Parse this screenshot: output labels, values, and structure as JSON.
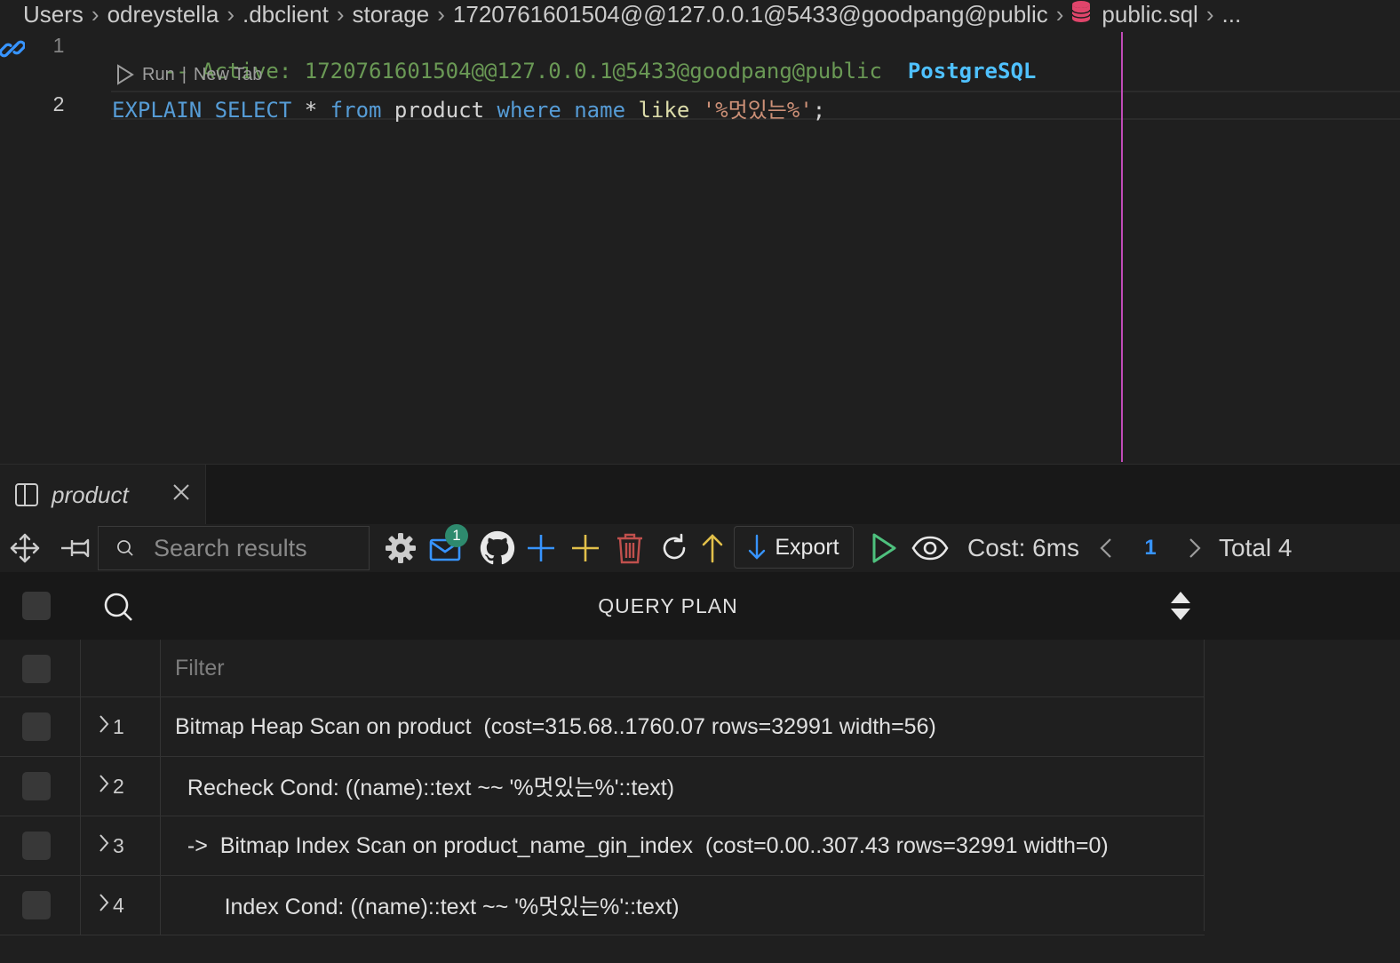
{
  "breadcrumb": {
    "segments": [
      "Users",
      ".dbclient",
      "storage",
      "1720761601504@@127.0.0.1@5433@goodpang@public",
      "public.sql",
      "..."
    ],
    "user": "odreystella"
  },
  "editor": {
    "line1": {
      "number": "1",
      "comment": "-- Active: 1720761601504@@127.0.0.1@5433@goodpang@public",
      "db_type": "PostgreSQL"
    },
    "codelens": {
      "run": "Run",
      "separator": "|",
      "new_tab": "New Tab"
    },
    "line2": {
      "number": "2",
      "explain": "EXPLAIN",
      "select": "SELECT",
      "star": "*",
      "from": "from",
      "table": "product",
      "where": "where",
      "column": "name",
      "like": "like",
      "literal": "'%멋있는%'",
      "semicolon": ";"
    }
  },
  "panel": {
    "tab_title": "product"
  },
  "toolbar": {
    "search_placeholder": "Search results",
    "mail_badge": "1",
    "export_label": "Export",
    "cost_label": "Cost: 6ms",
    "page": "1",
    "total_label": "Total 4"
  },
  "grid": {
    "column": "QUERY PLAN",
    "filter_placeholder": "Filter",
    "rows": [
      {
        "index": "1",
        "plan": "Bitmap Heap Scan on product  (cost=315.68..1760.07 rows=32991 width=56)"
      },
      {
        "index": "2",
        "plan": "  Recheck Cond: ((name)::text ~~ '%멋있는%'::text)"
      },
      {
        "index": "3",
        "plan": "  ->  Bitmap Index Scan on product_name_gin_index  (cost=0.00..307.43 rows=32991 width=0)"
      },
      {
        "index": "4",
        "plan": "        Index Cond: ((name)::text ~~ '%멋있는%'::text)"
      }
    ]
  },
  "colors": {
    "background": "#1f1f1f",
    "ruler": "#c04bb8",
    "keyword": "#569cd6",
    "string": "#ce9178",
    "comment": "#6a9955",
    "accent": "#3794ff",
    "run_green": "#4ec17e",
    "add_blue": "#3794ff",
    "add_yellow": "#e2c04a",
    "delete_red": "#c0504d"
  }
}
